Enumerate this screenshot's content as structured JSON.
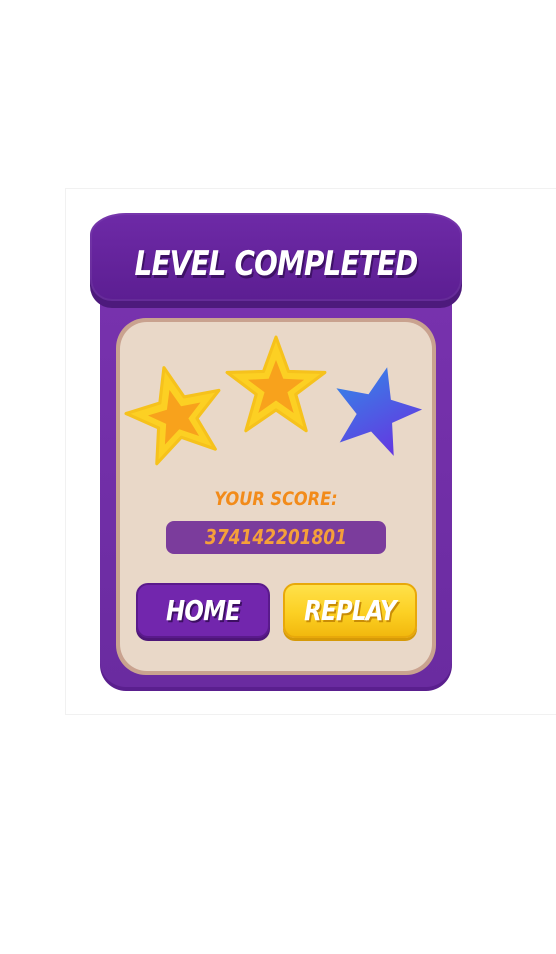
{
  "dialog": {
    "title": "LEVEL COMPLETED",
    "stars_earned": 2,
    "stars_total": 3,
    "score_label": "YOUR SCORE:",
    "score_value": "374142201801"
  },
  "buttons": {
    "home_label": "HOME",
    "replay_label": "REPLAY"
  },
  "colors": {
    "panel_purple": "#6a2ba0",
    "content_beige": "#e9d8c8",
    "star_filled": "#fcd023",
    "star_empty": "#4a5ee8",
    "score_orange": "#f28b1a",
    "replay_yellow": "#fcd023"
  }
}
